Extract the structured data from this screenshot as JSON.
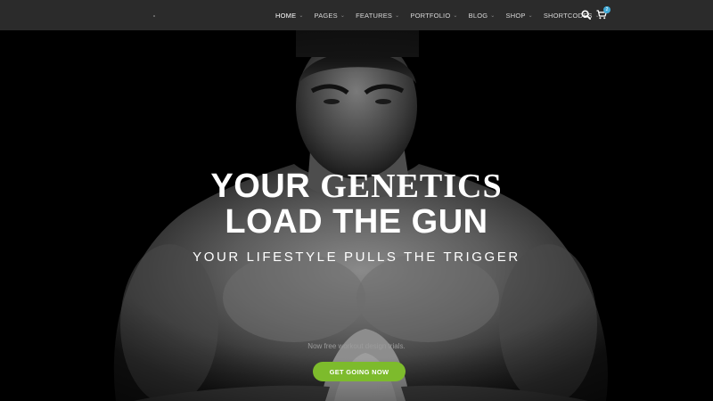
{
  "header": {
    "nav": [
      {
        "label": "HOME",
        "active": true
      },
      {
        "label": "PAGES",
        "active": false
      },
      {
        "label": "FEATURES",
        "active": false
      },
      {
        "label": "PORTFOLIO",
        "active": false
      },
      {
        "label": "BLOG",
        "active": false
      },
      {
        "label": "SHOP",
        "active": false
      },
      {
        "label": "SHORTCODES",
        "active": false
      }
    ],
    "icons": {
      "search": "search-icon",
      "cart": "cart-icon"
    },
    "cart_count": "2"
  },
  "hero": {
    "headline_line1_a": "YOUR ",
    "headline_line1_b": "GENETICS",
    "headline_line2": "LOAD THE GUN",
    "subheadline": "YOUR LIFESTYLE PULLS THE TRIGGER",
    "tagline": "Now free workout design trials.",
    "cta_label": "GET GOING NOW"
  },
  "colors": {
    "header_bg": "#2b2b2b",
    "accent_green": "#7dbb2c",
    "badge_blue": "#3fa9d6"
  }
}
